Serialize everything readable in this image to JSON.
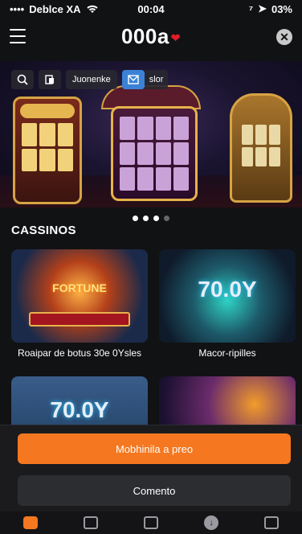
{
  "status_bar": {
    "carrier": "Deblce XA",
    "time": "00:04",
    "battery": "03%"
  },
  "header": {
    "logo": "000a",
    "logo_heart": "❤",
    "close_glyph": "✕"
  },
  "search_chips": {
    "chip_label": "Juonenke",
    "chip_label2": "slor"
  },
  "carousel": {
    "total": 4,
    "active": [
      true,
      true,
      true,
      false
    ]
  },
  "section": {
    "title": "CASSINOS"
  },
  "games": [
    {
      "name": "Roaipar de botus 30e 0Ysles",
      "art_text": "FORTUNE"
    },
    {
      "name": "Macor-ripilles",
      "art_text": "70.0Y"
    },
    {
      "name": "",
      "art_text": "70.0Y"
    },
    {
      "name": "",
      "art_text": ""
    }
  ],
  "overlay": {
    "primary_label": "Mobhinila a preo",
    "secondary_label": "Comento"
  },
  "colors": {
    "accent": "#f5771f",
    "logo_heart": "#e11d2b",
    "chip_blue": "#3b82d6"
  }
}
